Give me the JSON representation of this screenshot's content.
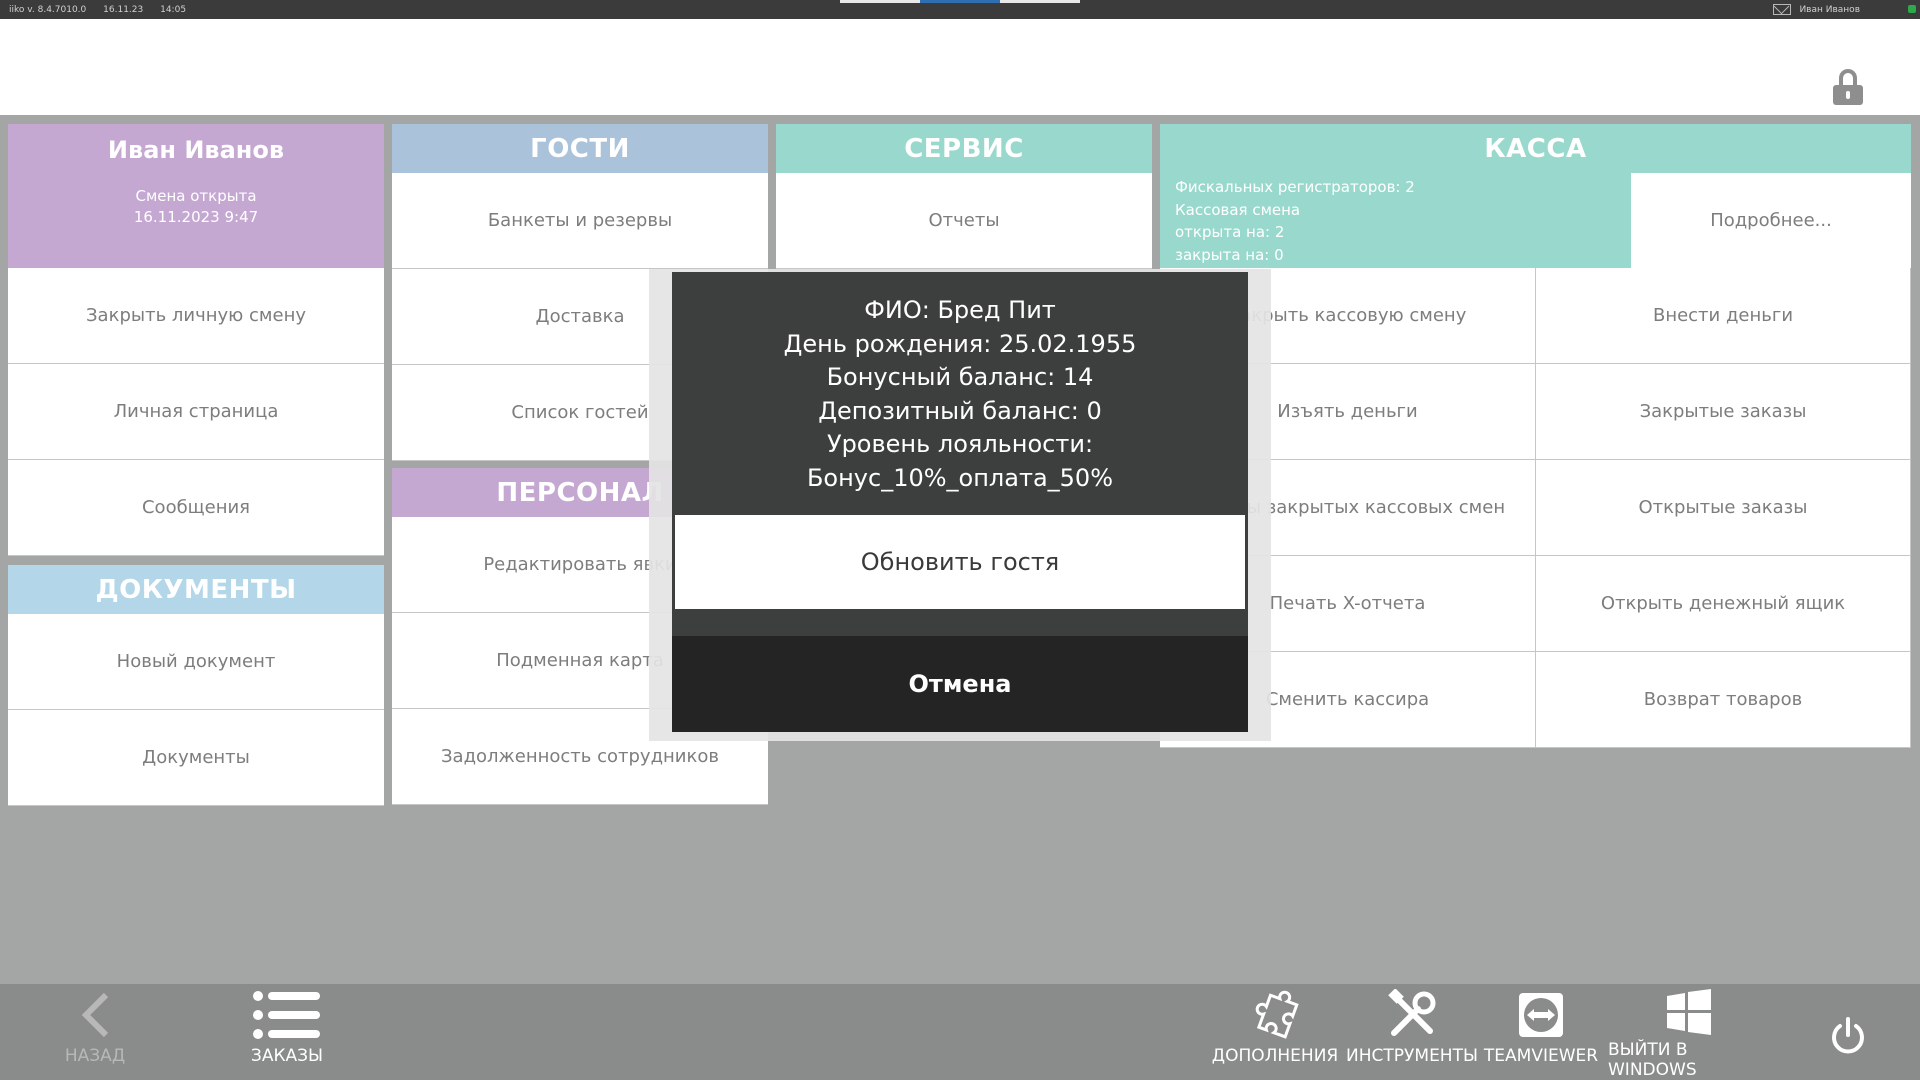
{
  "topbar": {
    "version": "iiko v. 8.4.7010.0",
    "date": "16.11.23",
    "time": "14:05",
    "user": "Иван Иванов"
  },
  "user_panel": {
    "name": "Иван Иванов",
    "shift_status": "Смена открыта",
    "shift_date": "16.11.2023 9:47",
    "items": [
      "Закрыть личную смену",
      "Личная страница",
      "Сообщения"
    ]
  },
  "documents_panel": {
    "title": "ДОКУМЕНТЫ",
    "items": [
      "Новый документ",
      "Документы"
    ]
  },
  "guests_panel": {
    "title": "ГОСТИ",
    "items": [
      "Банкеты и резервы",
      "Доставка",
      "Список гостей"
    ]
  },
  "staff_panel": {
    "title": "ПЕРСОНАЛ",
    "items": [
      "Редактировать явки",
      "Подменная карта",
      "Задолженность сотрудников"
    ]
  },
  "service_panel": {
    "title": "СЕРВИС",
    "items": [
      "Отчеты"
    ]
  },
  "kassa_panel": {
    "title": "КАССА",
    "info": [
      "Фискальных регистраторов: 2",
      "Кассовая смена",
      "открыта на: 2",
      "закрыта на: 0"
    ],
    "more": "Подробнее...",
    "items": [
      "Закрыть кассовую смену",
      "Внести деньги",
      "Изъять деньги",
      "Закрытые заказы",
      "Отчеты закрытых кассовых смен",
      "Открытые заказы",
      "Печать X-отчета",
      "Открыть денежный ящик",
      "Сменить кассира",
      "Возврат товаров"
    ]
  },
  "modal": {
    "fio": "ФИО: Бред Пит",
    "birthday": "День рождения: 25.02.1955",
    "bonus": "Бонусный баланс: 14",
    "deposit": "Депозитный баланс: 0",
    "loyalty": "Уровень лояльности: Бонус_10%_оплата_50%",
    "update_label": "Обновить гостя",
    "cancel_label": "Отмена"
  },
  "bottombar": {
    "back": "НАЗАД",
    "orders": "ЗАКАЗЫ",
    "addons": "ДОПОЛНЕНИЯ",
    "tools": "ИНСТРУМЕНТЫ",
    "teamviewer": "TEAMVIEWER",
    "windows": "ВЫЙТИ В WINDOWS"
  },
  "colors": {
    "user": "#c4a8d2",
    "guests": "#abc3da",
    "service": "#99d9cd",
    "kassa": "#99d9cd",
    "staff": "#c4a8d2",
    "documents": "#b3d6e9",
    "modal_bg": "#3d3f3f",
    "cancel_bg": "#242424"
  },
  "icons": {
    "lock": "lock-icon",
    "back": "chevron-left-icon",
    "orders": "list-icon",
    "addons": "puzzle-icon",
    "tools": "tools-icon",
    "teamviewer": "teamviewer-icon",
    "windows": "windows-icon",
    "power": "power-icon"
  }
}
